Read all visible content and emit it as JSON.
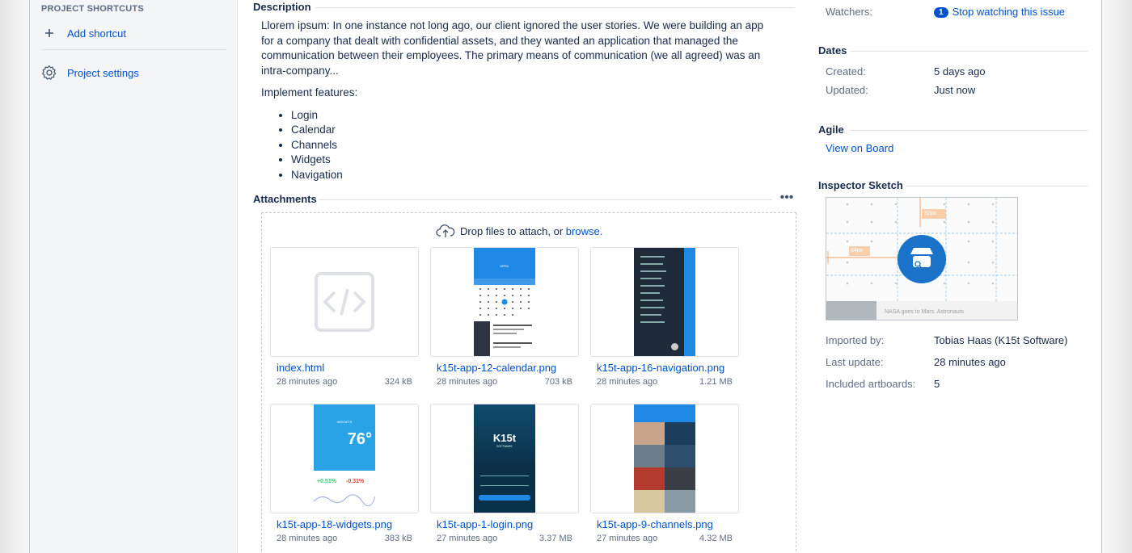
{
  "sidebar": {
    "heading": "PROJECT SHORTCUTS",
    "add_shortcut": "Add shortcut",
    "settings": "Project settings"
  },
  "main": {
    "description_title": "Description",
    "description_para": "Llorem ipsum: In one instance not long ago, our client ignored the user stories. We were building an app for a company that dealt with confidential assets, and they wanted an application that managed the communication between their employees. The primary means of communication (we all agreed) was an intra-company...",
    "features_intro": "Implement features:",
    "features": [
      "Login",
      "Calendar",
      "Channels",
      "Widgets",
      "Navigation"
    ],
    "attachments_title": "Attachments",
    "more_label": "•••",
    "drop_text": "Drop files to attach, or",
    "browse_text": "browse.",
    "attachments": [
      {
        "name": "index.html",
        "time": "28 minutes ago",
        "size": "324 kB"
      },
      {
        "name": "k15t-app-12-calendar.png",
        "time": "28 minutes ago",
        "size": "703 kB"
      },
      {
        "name": "k15t-app-16-navigation.png",
        "time": "28 minutes ago",
        "size": "1.21 MB"
      },
      {
        "name": "k15t-app-18-widgets.png",
        "time": "28 minutes ago",
        "size": "383 kB"
      },
      {
        "name": "k15t-app-1-login.png",
        "time": "27 minutes ago",
        "size": "3.37 MB"
      },
      {
        "name": "k15t-app-9-channels.png",
        "time": "27 minutes ago",
        "size": "4.32 MB"
      }
    ],
    "thumb_text": {
      "calendar_month": "APRIL",
      "widgets_title": "WIDGETS",
      "widgets_temp": "76°",
      "widgets_up": "+0.51%",
      "widgets_down": "-0.31%",
      "login_logo": "K15t",
      "login_sub": "SOFTWARE"
    }
  },
  "right": {
    "watchers_label": "Watchers:",
    "watch_count": "1",
    "watch_link": "Stop watching this issue",
    "dates_title": "Dates",
    "created_label": "Created:",
    "created_value": "5 days ago",
    "updated_label": "Updated:",
    "updated_value": "Just now",
    "agile_title": "Agile",
    "agile_link": "View on Board",
    "inspector_title": "Inspector Sketch",
    "sketch_measure_1": "32px",
    "sketch_measure_2": "64px",
    "sketch_caption": "NASA goes to Mars. Astronauts",
    "imported_label": "Imported by:",
    "imported_value": "Tobias Haas (K15t Software)",
    "lastupdate_label": "Last update:",
    "lastupdate_value": "28 minutes ago",
    "artboards_label": "Included artboards:",
    "artboards_value": "5"
  },
  "colors": {
    "link": "#0052cc",
    "accent_blue": "#1e88e5",
    "sketch_badge": "#1a73c9",
    "measure_orange": "#f5a25d"
  }
}
